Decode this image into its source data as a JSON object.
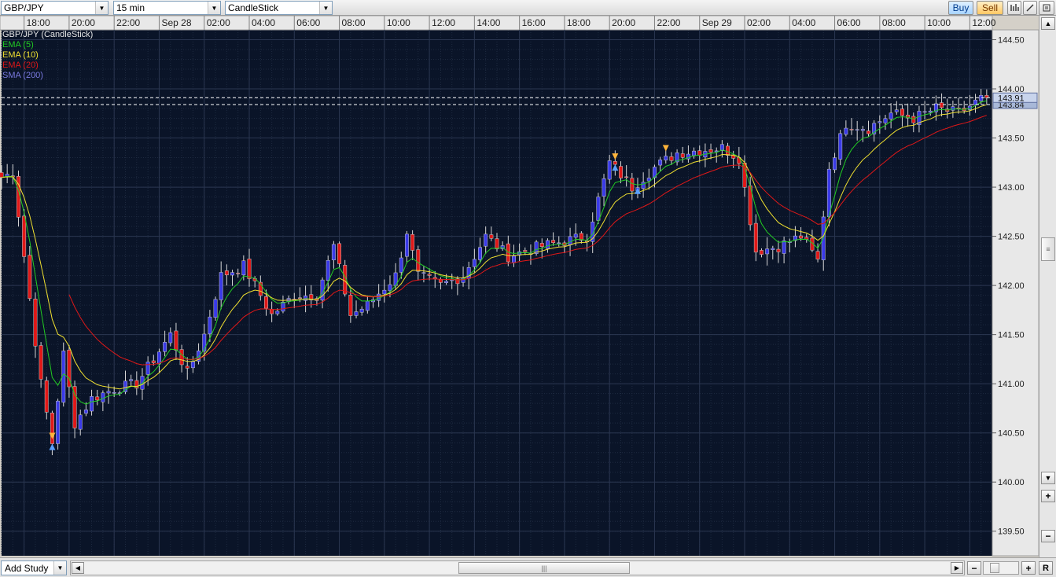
{
  "toolbar": {
    "symbol": "GBP/JPY",
    "interval": "15 min",
    "chart_type": "CandleStick",
    "buy_label": "Buy",
    "sell_label": "Sell"
  },
  "legend": [
    {
      "label": "GBP/JPY (CandleStick)",
      "color": "#e6e6e6"
    },
    {
      "label": "EMA (5)",
      "color": "#22cc22"
    },
    {
      "label": "EMA (10)",
      "color": "#f0e030"
    },
    {
      "label": "EMA (20)",
      "color": "#e01818"
    },
    {
      "label": "SMA (200)",
      "color": "#7a7ae0"
    }
  ],
  "price_axis": {
    "ticks": [
      "144.50",
      "144.00",
      "143.50",
      "143.00",
      "142.50",
      "142.00",
      "141.50",
      "141.00",
      "140.50",
      "140.00",
      "139.50"
    ],
    "current_price": "143.91",
    "bid_price": "143.84"
  },
  "time_axis": {
    "ticks": [
      "18:00",
      "20:00",
      "22:00",
      "Sep 28",
      "02:00",
      "04:00",
      "06:00",
      "08:00",
      "10:00",
      "12:00",
      "14:00",
      "16:00",
      "18:00",
      "20:00",
      "22:00",
      "Sep 29",
      "02:00",
      "04:00",
      "06:00",
      "08:00",
      "10:00",
      "12:00",
      "1"
    ]
  },
  "bottombar": {
    "add_study_label": "Add Study"
  },
  "colors": {
    "background": "#0a1428",
    "grid": "#1e2a40",
    "up_candle": "#3a3ae8",
    "down_candle": "#e01818",
    "wick": "#d8d8d8",
    "ema5": "#22cc22",
    "ema10": "#f0e030",
    "ema20": "#e01818",
    "marker_up": "#5aa0ff",
    "marker_down": "#ffb43a"
  },
  "chart_data": {
    "type": "candlestick",
    "symbol": "GBP/JPY",
    "interval": "15 min",
    "ylim": [
      139.25,
      144.6
    ],
    "x_range": [
      "Sep 27 17:00",
      "Sep 29 13:00"
    ],
    "waypoints_close": [
      [
        "Sep 27 17:00",
        143.1
      ],
      [
        "Sep 27 17:30",
        143.15
      ],
      [
        "Sep 27 18:00",
        142.3
      ],
      [
        "Sep 27 18:45",
        141.0
      ],
      [
        "Sep 27 19:15",
        140.4
      ],
      [
        "Sep 27 19:45",
        141.3
      ],
      [
        "Sep 27 20:15",
        140.6
      ],
      [
        "Sep 27 21:00",
        140.85
      ],
      [
        "Sep 27 22:00",
        140.95
      ],
      [
        "Sep 27 23:00",
        141.0
      ],
      [
        "Sep 28 00:30",
        141.5
      ],
      [
        "Sep 28 01:15",
        141.1
      ],
      [
        "Sep 28 02:00",
        141.5
      ],
      [
        "Sep 28 02:45",
        142.1
      ],
      [
        "Sep 28 03:45",
        142.2
      ],
      [
        "Sep 28 04:15",
        142.0
      ],
      [
        "Sep 28 05:00",
        141.7
      ],
      [
        "Sep 28 06:00",
        141.9
      ],
      [
        "Sep 28 07:00",
        141.9
      ],
      [
        "Sep 28 07:45",
        142.4
      ],
      [
        "Sep 28 08:30",
        141.7
      ],
      [
        "Sep 28 09:15",
        141.8
      ],
      [
        "Sep 28 10:30",
        142.1
      ],
      [
        "Sep 28 11:00",
        142.55
      ],
      [
        "Sep 28 11:30",
        142.1
      ],
      [
        "Sep 28 12:30",
        142.0
      ],
      [
        "Sep 28 13:30",
        142.1
      ],
      [
        "Sep 28 14:30",
        142.5
      ],
      [
        "Sep 28 15:30",
        142.3
      ],
      [
        "Sep 28 17:00",
        142.4
      ],
      [
        "Sep 28 19:00",
        142.5
      ],
      [
        "Sep 28 20:00",
        143.25
      ],
      [
        "Sep 28 21:00",
        143.0
      ],
      [
        "Sep 28 22:00",
        143.2
      ],
      [
        "Sep 28 23:00",
        143.35
      ],
      [
        "Sep 29 01:00",
        143.4
      ],
      [
        "Sep 29 01:45",
        143.3
      ],
      [
        "Sep 29 02:30",
        142.35
      ],
      [
        "Sep 29 03:30",
        142.4
      ],
      [
        "Sep 29 04:30",
        142.5
      ],
      [
        "Sep 29 05:15",
        142.25
      ],
      [
        "Sep 29 05:45",
        143.2
      ],
      [
        "Sep 29 06:30",
        143.65
      ],
      [
        "Sep 29 07:30",
        143.6
      ],
      [
        "Sep 29 08:30",
        143.75
      ],
      [
        "Sep 29 09:30",
        143.7
      ],
      [
        "Sep 29 10:30",
        143.8
      ],
      [
        "Sep 29 11:30",
        143.75
      ],
      [
        "Sep 29 12:30",
        143.9
      ],
      [
        "Sep 29 12:45",
        143.91
      ]
    ],
    "current_price": 143.91,
    "bid_price": 143.84,
    "markers": [
      {
        "time": "Sep 27 19:15",
        "type": "buy"
      },
      {
        "time": "Sep 27 19:20",
        "type": "sell"
      },
      {
        "time": "Sep 28 20:15",
        "type": "buy"
      },
      {
        "time": "Sep 28 20:15",
        "type": "sell"
      },
      {
        "time": "Sep 28 21:15",
        "type": "buy"
      },
      {
        "time": "Sep 28 22:30",
        "type": "sell"
      }
    ]
  }
}
